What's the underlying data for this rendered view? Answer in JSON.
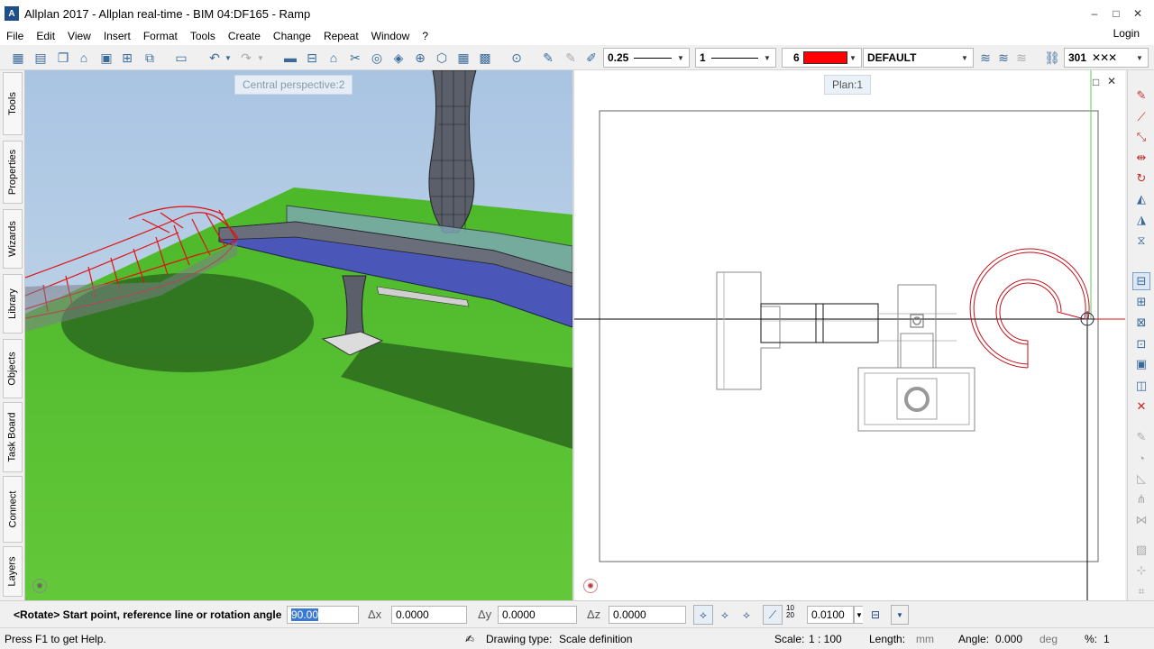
{
  "window": {
    "title": "Allplan 2017 - Allplan real-time - BIM 04:DF165 - Ramp",
    "app_icon": "allplan-icon",
    "controls": {
      "minimize": "–",
      "maximize": "□",
      "close": "✕"
    }
  },
  "menu": {
    "items": [
      "File",
      "Edit",
      "View",
      "Insert",
      "Format",
      "Tools",
      "Create",
      "Change",
      "Repeat",
      "Window",
      "?"
    ],
    "login": "Login"
  },
  "toolbar": {
    "pen_thickness": "0.25",
    "line_type": "1",
    "color_number": "6",
    "color_hex": "#ff0000",
    "layer": "DEFAULT",
    "pattern_number": "301"
  },
  "left_tabs": [
    "Tools",
    "Properties",
    "Wizards",
    "Library",
    "Objects",
    "Task Board",
    "Connect",
    "Layers"
  ],
  "viewport_3d": {
    "label": "Central perspective:2"
  },
  "viewport_plan": {
    "label": "Plan:1"
  },
  "dialog": {
    "prompt": "<Rotate> Start point, reference line or rotation angle",
    "angle_value": "90.00",
    "dx_label": "Δx",
    "dx_value": "0.0000",
    "dy_label": "Δy",
    "dy_value": "0.0000",
    "dz_label": "Δz",
    "dz_value": "0.0000",
    "track_label": "10 20",
    "track_value": "0.0100"
  },
  "status": {
    "help": "Press F1 to get Help.",
    "drawing_type_label": "Drawing type:",
    "drawing_type_value": "Scale definition",
    "scale_label": "Scale:",
    "scale_value": "1 : 100",
    "length_label": "Length:",
    "length_unit": "mm",
    "angle_label": "Angle:",
    "angle_value": "0.000",
    "angle_unit": "deg",
    "percent_label": "%:",
    "percent_value": "1"
  }
}
